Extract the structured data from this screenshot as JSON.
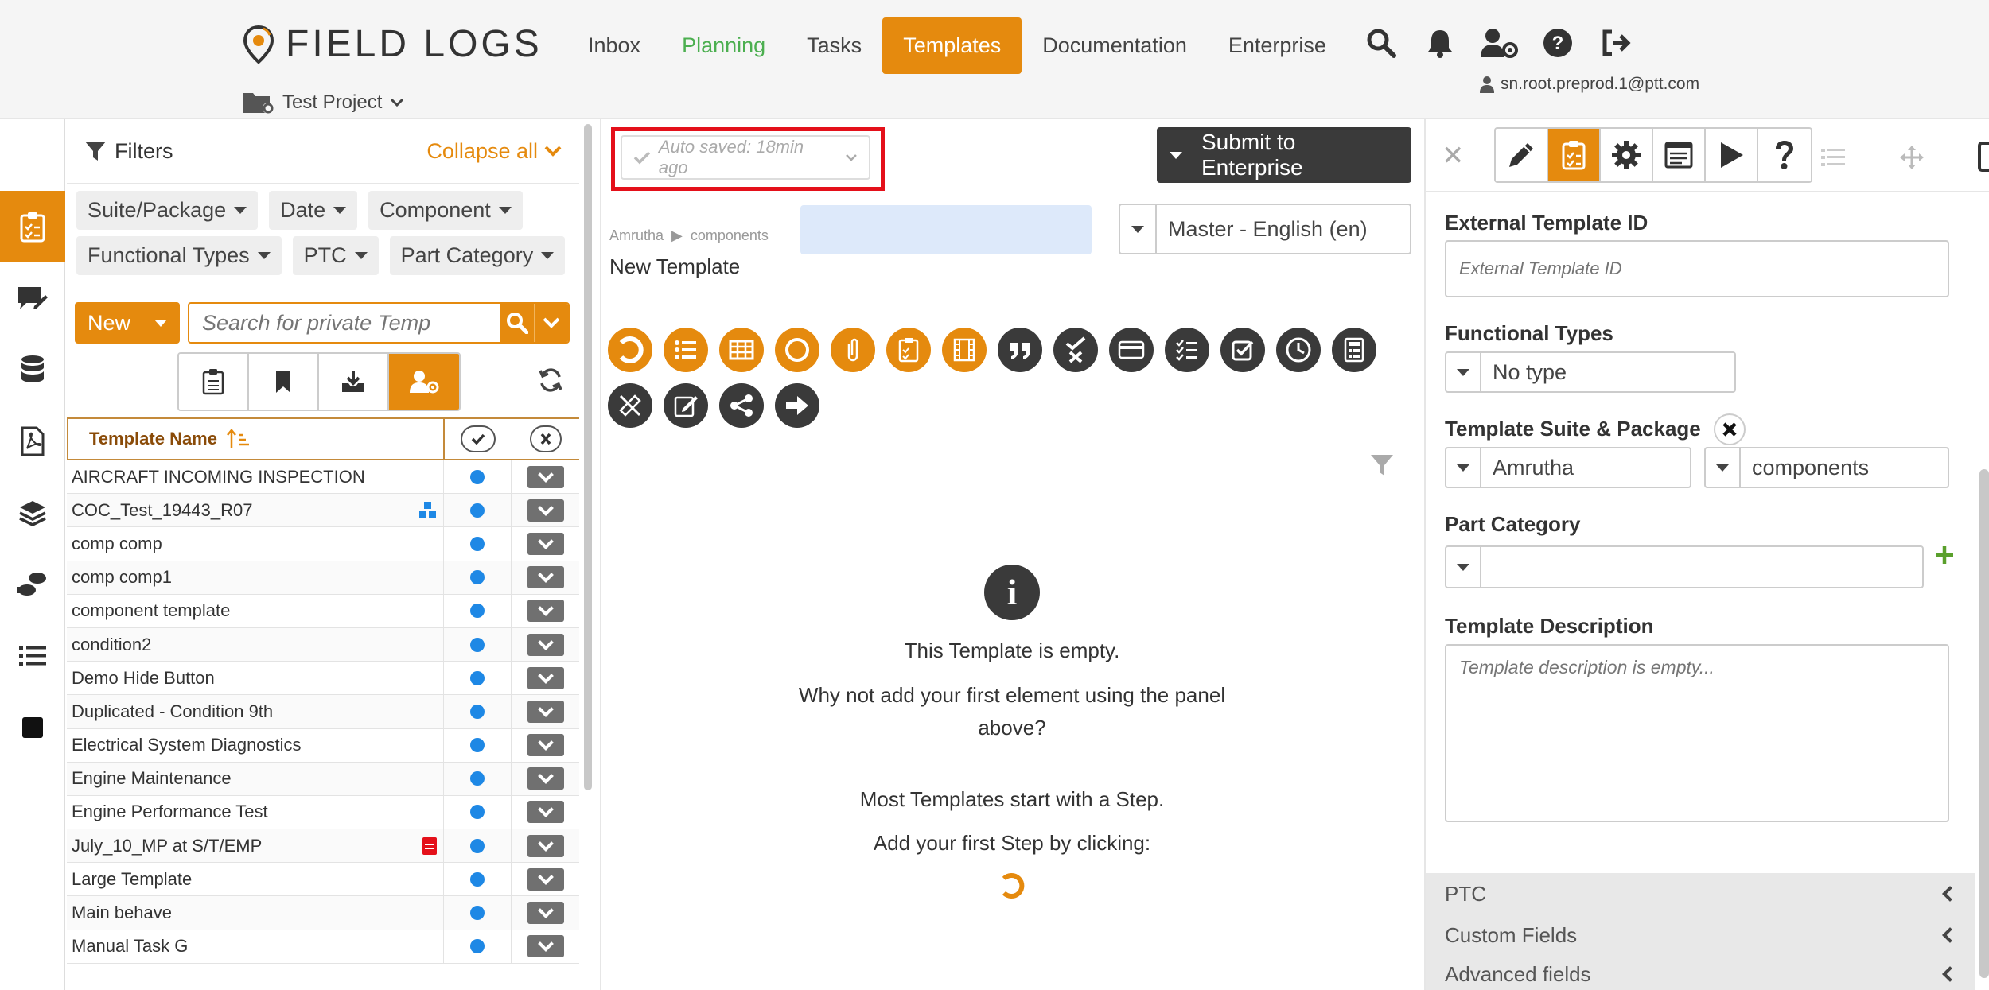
{
  "header": {
    "logo_text": "FIELD LOGS",
    "nav": [
      {
        "label": "Inbox"
      },
      {
        "label": "Planning"
      },
      {
        "label": "Tasks"
      },
      {
        "label": "Templates"
      },
      {
        "label": "Documentation"
      },
      {
        "label": "Enterprise"
      }
    ],
    "active_nav": "Templates",
    "user_email": "sn.root.preprod.1@ptt.com",
    "project": "Test Project"
  },
  "filters": {
    "title": "Filters",
    "collapse_label": "Collapse all",
    "chips_row1": [
      "Suite/Package",
      "Date",
      "Component"
    ],
    "chips_row2": [
      "Functional Types",
      "PTC",
      "Part Category"
    ],
    "new_label": "New",
    "search_placeholder": "Search for private Temp"
  },
  "table": {
    "header_name": "Template Name",
    "rows": [
      {
        "name": "AIRCRAFT INCOMING INSPECTION",
        "badge": ""
      },
      {
        "name": "COC_Test_19443_R07",
        "badge": "component-badge-icon"
      },
      {
        "name": "comp comp",
        "badge": ""
      },
      {
        "name": "comp comp1",
        "badge": ""
      },
      {
        "name": "component template",
        "badge": ""
      },
      {
        "name": "condition2",
        "badge": ""
      },
      {
        "name": "Demo Hide Button",
        "badge": ""
      },
      {
        "name": "Duplicated - Condition 9th",
        "badge": ""
      },
      {
        "name": "Electrical System Diagnostics",
        "badge": ""
      },
      {
        "name": "Engine Maintenance",
        "badge": ""
      },
      {
        "name": "Engine Performance Test",
        "badge": ""
      },
      {
        "name": "July_10_MP at S/T/EMP",
        "badge": "red-doc-icon"
      },
      {
        "name": "Large Template",
        "badge": ""
      },
      {
        "name": "Main behave",
        "badge": ""
      },
      {
        "name": "Manual Task G",
        "badge": ""
      }
    ]
  },
  "editor": {
    "autosave_text": "Auto saved: 18min ago",
    "submit_label": "Submit to Enterprise",
    "breadcrumb": [
      "Amrutha",
      "components"
    ],
    "template_title": "New Template",
    "language": "Master - English (en)",
    "palette_icons": [
      "step-icon",
      "list-icon",
      "table-icon",
      "circle-icon",
      "attachment-icon",
      "clipboard-icon",
      "film-icon",
      "quote-icon",
      "check-cross-icon",
      "card-icon",
      "checklist-icon",
      "checkbox-icon",
      "clock-icon",
      "calculator-icon",
      "ruler-pencil-icon",
      "edit-icon",
      "share-icon",
      "arrow-right-icon"
    ],
    "empty_line1": "This Template is empty.",
    "empty_line2": "Why not add your first element using the panel above?",
    "empty_line3": "Most Templates start with a Step.",
    "empty_line4": "Add your first Step by clicking:"
  },
  "properties": {
    "external_id_label": "External Template ID",
    "external_id_placeholder": "External Template ID",
    "functional_types_label": "Functional Types",
    "functional_types_value": "No type",
    "suite_package_label": "Template Suite & Package",
    "suite_value": "Amrutha",
    "package_value": "components",
    "part_category_label": "Part Category",
    "part_category_value": "",
    "description_label": "Template Description",
    "description_placeholder": "Template description is empty...",
    "sections": [
      "PTC",
      "Custom Fields",
      "Advanced fields"
    ]
  },
  "colors": {
    "accent": "#e58a0e",
    "green_nav": "#4caf50",
    "dark": "#3a3a3a",
    "status_dot": "#1e88e5",
    "highlight_red": "#e4101a"
  }
}
